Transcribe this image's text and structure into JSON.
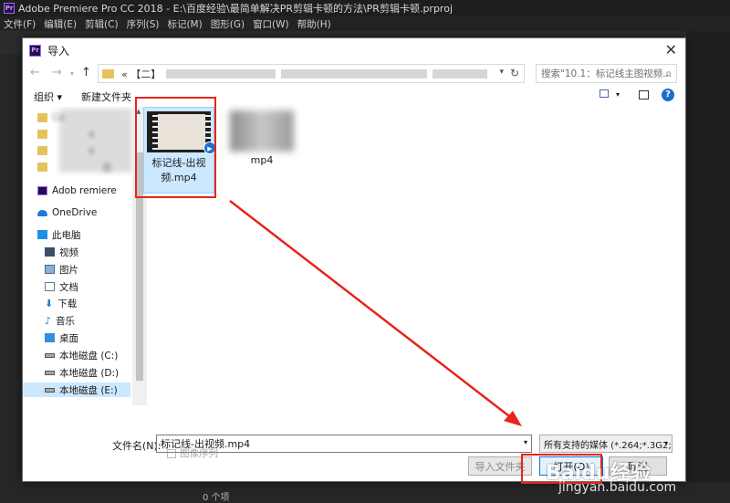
{
  "app": {
    "title": "Adobe Premiere Pro CC 2018 - E:\\百度经验\\最简单解决PR剪辑卡顿的方法\\PR剪辑卡顿.prproj",
    "logo": "Pr",
    "menu": [
      "文件(F)",
      "编辑(E)",
      "剪辑(C)",
      "序列(S)",
      "标记(M)",
      "图形(G)",
      "窗口(W)",
      "帮助(H)"
    ],
    "item_count": "0 个项"
  },
  "dialog": {
    "title": "导入",
    "close": "✕",
    "address": "« 【二】",
    "search_placeholder": "搜索\"10.1：标记线主图视频...",
    "organize": "组织 ▾",
    "new_folder": "新建文件夹",
    "help": "?"
  },
  "sidebar": {
    "items": [
      {
        "label": "Co",
        "icon": "folder-icon"
      },
      {
        "label": "a",
        "icon": "folder-icon"
      },
      {
        "label": "a",
        "icon": "folder-icon"
      },
      {
        "label": "态",
        "icon": "folder-icon"
      },
      {
        "label": "Adob  remiere",
        "icon": "premiere-icon"
      },
      {
        "label": "OneDrive",
        "icon": "onedrive-icon"
      },
      {
        "label": "此电脑",
        "icon": "computer-icon"
      },
      {
        "label": "视频",
        "icon": "video-folder-icon"
      },
      {
        "label": "图片",
        "icon": "picture-folder-icon"
      },
      {
        "label": "文档",
        "icon": "document-folder-icon"
      },
      {
        "label": "下载",
        "icon": "download-icon"
      },
      {
        "label": "音乐",
        "icon": "music-icon"
      },
      {
        "label": "桌面",
        "icon": "desktop-icon"
      },
      {
        "label": "本地磁盘 (C:)",
        "icon": "disk-icon"
      },
      {
        "label": "本地磁盘 (D:)",
        "icon": "disk-icon"
      },
      {
        "label": "本地磁盘 (E:)",
        "icon": "disk-icon"
      }
    ]
  },
  "files": [
    {
      "name": "标记线-出视频.mp4",
      "selected": true
    },
    {
      "name": "mp4",
      "selected": false
    }
  ],
  "image_sequence": "图像序列",
  "filename_label": "文件名(N):",
  "filename_value": "标记线-出视频.mp4",
  "filter": "所有支持的媒体 (*.264;*.3G2;*",
  "buttons": {
    "import_folder": "导入文件夹",
    "open": "打开(O)",
    "cancel": "取消"
  },
  "watermark": {
    "brand": "Baidu经验",
    "url": "jingyan.baidu.com"
  },
  "colors": {
    "annotation": "#e8231b",
    "selection": "#cce8ff",
    "premiere_purple": "#9a6bff"
  }
}
